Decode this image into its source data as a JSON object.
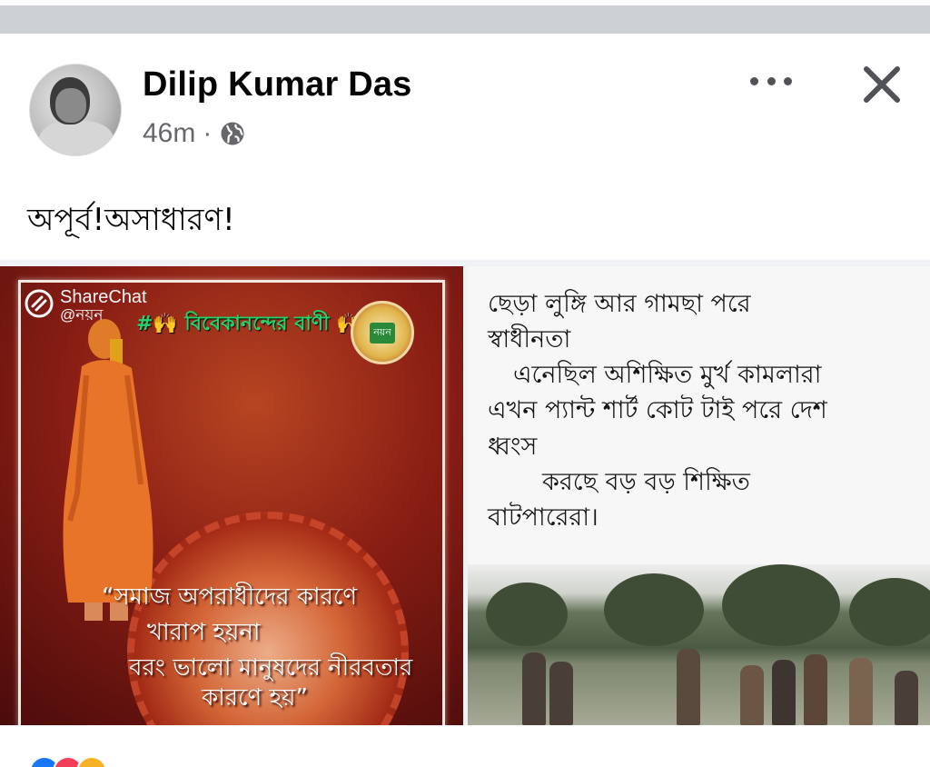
{
  "post": {
    "author": "Dilip Kumar Das",
    "time": "46m",
    "separator": "·",
    "caption": "অপূর্ব!অসাধারণ!"
  },
  "icons": {
    "avatar": "avatar-photo",
    "privacy": "globe-icon",
    "more": "more-horizontal-icon",
    "close": "close-icon"
  },
  "media": {
    "left": {
      "watermark_brand": "ShareChat",
      "watermark_handle": "@নয়ন",
      "banner": "#🙌 বিবেকানন্দের বাণী 🙌",
      "badge": "নয়ন",
      "quote_lines": [
        "“সমাজ অপরাধীদের কারণে",
        "খারাপ হয়না",
        "বরং ভালো মানুষদের নীরবতার",
        "কারণে হয়”"
      ]
    },
    "right": {
      "poem_lines": [
        "ছেড়া লুঙ্গি আর গামছা পরে",
        "স্বাধীনতা",
        "এনেছিল অশিক্ষিত মুর্খ কামলারা",
        "এখন প্যান্ট শার্ট কোট টাই পরে দেশ",
        "ধ্বংস",
        "করছে বড় বড় শিক্ষিত",
        "বাটপারেরা।"
      ]
    }
  },
  "colors": {
    "text_primary": "#050505",
    "text_secondary": "#65676b",
    "top_bar": "#cdd0d5",
    "like_blue": "#1877f2",
    "love_red": "#f33e58",
    "haha_yellow": "#f7b125"
  }
}
